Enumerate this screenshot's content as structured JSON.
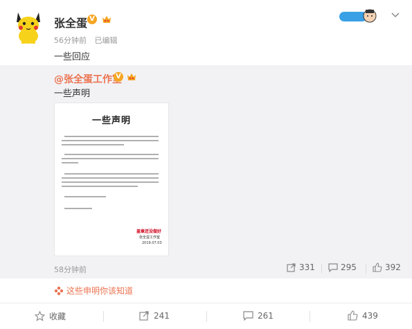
{
  "post": {
    "author": "张全蛋",
    "v_badge": "V",
    "time": "56分钟前",
    "edited": "已编辑",
    "text": "一些回应"
  },
  "repost": {
    "author": "@张全蛋工作室",
    "v_badge": "V",
    "text": "一些声明",
    "image": {
      "title": "一些声明",
      "stamp_text": "盖章还没做好",
      "signature": "张全蛋工作室",
      "date": "2019.07.03"
    },
    "time": "58分钟前",
    "repost_count": "331",
    "comment_count": "295",
    "like_count": "392"
  },
  "link": {
    "text": "这些申明你该知道"
  },
  "footer": {
    "favorite_label": "收藏",
    "repost_count": "241",
    "comment_count": "261",
    "like_count": "439"
  },
  "colors": {
    "accent": "#eb7350",
    "link": "#eb7350",
    "badge": "#f5a623",
    "repost_bg": "#f2f2f5"
  }
}
